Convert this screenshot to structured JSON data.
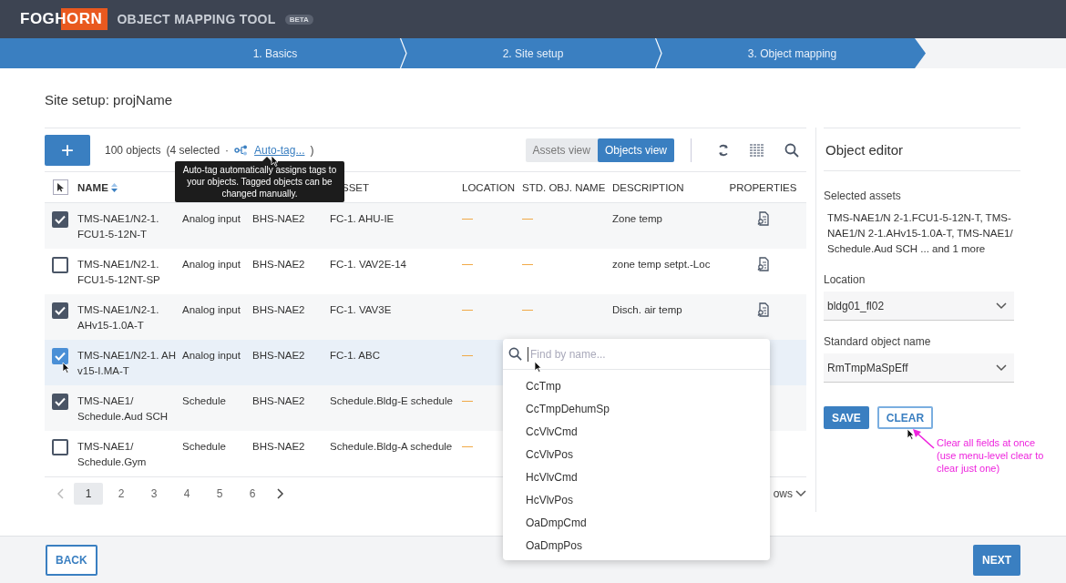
{
  "app": {
    "logo": "FOGHORN",
    "title": "OBJECT MAPPING TOOL",
    "badge": "BETA"
  },
  "steps": [
    {
      "label": "1. Basics"
    },
    {
      "label": "2. Site setup"
    },
    {
      "label": "3. Object mapping"
    }
  ],
  "page_title": "Site setup: projName",
  "toolbar": {
    "add": "+",
    "count": "100 objects",
    "selected_count": "(4 selected",
    "separator": "·",
    "autotag": "Auto-tag...",
    "close_paren": ")",
    "views": [
      {
        "label": "Assets view",
        "selected": false
      },
      {
        "label": "Objects view",
        "selected": true
      }
    ]
  },
  "tooltip": "Auto-tag automatically assigns tags to your objects. Tagged objects can be changed manually.",
  "table": {
    "columns": [
      {
        "label": "NAME",
        "sort": true
      },
      {},
      {},
      {
        "label": "SSET"
      },
      {
        "label": "LOCATION"
      },
      {
        "label": "STD. OBJ. NAME"
      },
      {
        "label": "DESCRIPTION"
      },
      {
        "label": "PROPERTIES"
      }
    ],
    "rows": [
      {
        "checked": true,
        "name": "TMS-NAE1/N2-1. FCU1-5-12N-T",
        "type": "Analog input",
        "controller": "BHS-NAE2",
        "asset": "FC-1. AHU-IE",
        "location": "—",
        "std": "—",
        "description": "Zone temp",
        "properties": true
      },
      {
        "checked": false,
        "name": "TMS-NAE1/N2-1. FCU1-5-12NT-SP",
        "type": "Analog input",
        "controller": "BHS-NAE2",
        "asset": "FC-1. VAV2E-14",
        "location": "—",
        "std": "—",
        "description": "zone temp setpt.-Loc",
        "properties": true
      },
      {
        "checked": true,
        "name": "TMS-NAE1/N2-1. AHv15-1.0A-T",
        "type": "Analog input",
        "controller": "BHS-NAE2",
        "asset": "FC-1. VAV3E",
        "location": "—",
        "std": "—",
        "description": "Disch. air temp",
        "properties": true
      },
      {
        "checked": true,
        "hover": true,
        "name": "TMS-NAE1/N2-1. AH v15-I.MA-T",
        "type": "Analog input",
        "controller": "BHS-NAE2",
        "asset": "FC-1. ABC",
        "location": "—"
      },
      {
        "checked": true,
        "name": "TMS-NAE1/ Schedule.Aud SCH",
        "type": "Schedule",
        "controller": "BHS-NAE2",
        "asset": "Schedule.Bldg-E schedule",
        "location": "—"
      },
      {
        "checked": false,
        "name": "TMS-NAE1/ Schedule.Gym",
        "type": "Schedule",
        "controller": "BHS-NAE2",
        "asset": "Schedule.Bldg-A schedule",
        "location": "—"
      }
    ]
  },
  "pagination": {
    "pages": [
      {
        "label": "1",
        "selected": true
      },
      {
        "label": "2",
        "selected": false
      },
      {
        "label": "3",
        "selected": false
      },
      {
        "label": "4",
        "selected": false
      },
      {
        "label": "5",
        "selected": false
      },
      {
        "label": "6",
        "selected": false
      }
    ],
    "rows_label": "ows"
  },
  "dropdown": {
    "placeholder": "Find by name...",
    "options": [
      "CcTmp",
      "CcTmpDehumSp",
      "CcVlvCmd",
      "CcVlvPos",
      "HcVlvCmd",
      "HcVlvPos",
      "OaDmpCmd",
      "OaDmpPos"
    ]
  },
  "editor": {
    "title": "Object editor",
    "selected_label": "Selected assets",
    "selected_text": "TMS-NAE1/N 2-1.FCU1-5-12N-T, TMS-NAE1/N 2-1.AHv15-1.0A-T, TMS-NAE1/ Schedule.Aud SCH ... and 1 more",
    "fields": [
      {
        "label": "Location",
        "value": "bldg01_fl02"
      },
      {
        "label": "Standard object name",
        "value": "RmTmpMaSpEff"
      }
    ],
    "save": "SAVE",
    "clear": "CLEAR",
    "note": "Clear all fields at once (use menu-level clear to clear just one)"
  },
  "footer": {
    "back": "BACK",
    "next": "NEXT"
  }
}
